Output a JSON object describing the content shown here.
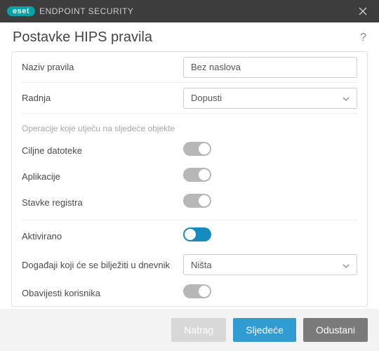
{
  "titlebar": {
    "brand_badge": "eset",
    "brand_text": "ENDPOINT SECURITY"
  },
  "header": {
    "title": "Postavke HIPS pravila"
  },
  "fields": {
    "rule_name_label": "Naziv pravila",
    "rule_name_value": "Bez naslova",
    "action_label": "Radnja",
    "action_value": "Dopusti",
    "section_caption": "Operacije koje utječu na sljedeće objekte",
    "target_files_label": "Ciljne datoteke",
    "applications_label": "Aplikacije",
    "registry_label": "Stavke registra",
    "activated_label": "Aktivirano",
    "log_events_label": "Događaji koji će se bilježiti u dnevnik",
    "log_events_value": "Ništa",
    "notify_user_label": "Obavijesti korisnika"
  },
  "toggles": {
    "target_files": false,
    "applications": false,
    "registry": false,
    "activated": true,
    "notify_user": false
  },
  "footer": {
    "back": "Natrag",
    "next": "Sljedeće",
    "cancel": "Odustani"
  }
}
